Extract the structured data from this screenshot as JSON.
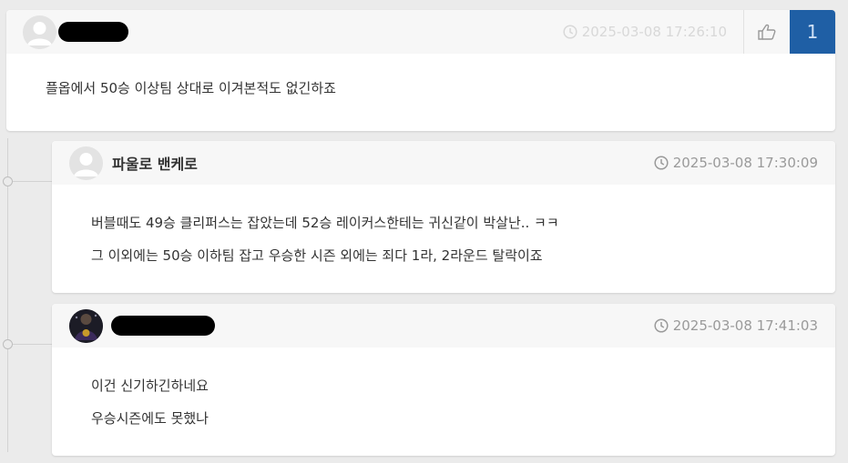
{
  "comments": [
    {
      "timestamp": "2025-03-08 17:26:10",
      "lines": [
        "플옵에서 50승 이상팀 상대로 이겨본적도 없긴하죠"
      ],
      "like_count": "1"
    },
    {
      "author": "파울로 밴케로",
      "timestamp": "2025-03-08 17:30:09",
      "lines": [
        "버블때도 49승 클리퍼스는 잡았는데 52승 레이커스한테는 귀신같이 박살난.. ㅋㅋ",
        "그 이외에는 50승 이하팀 잡고 우승한 시즌 외에는 죄다 1라, 2라운드 탈락이죠"
      ]
    },
    {
      "timestamp": "2025-03-08 17:41:03",
      "lines": [
        "이건 신기하긴하네요",
        "우승시즌에도 못했나"
      ]
    }
  ],
  "icons": {
    "clock": "clock-icon",
    "thumbs_up": "thumbs-up-icon",
    "avatar_placeholder": "user-avatar-icon"
  },
  "colors": {
    "like_count_bg": "#1f5fa5",
    "page_bg": "#ebebeb"
  }
}
